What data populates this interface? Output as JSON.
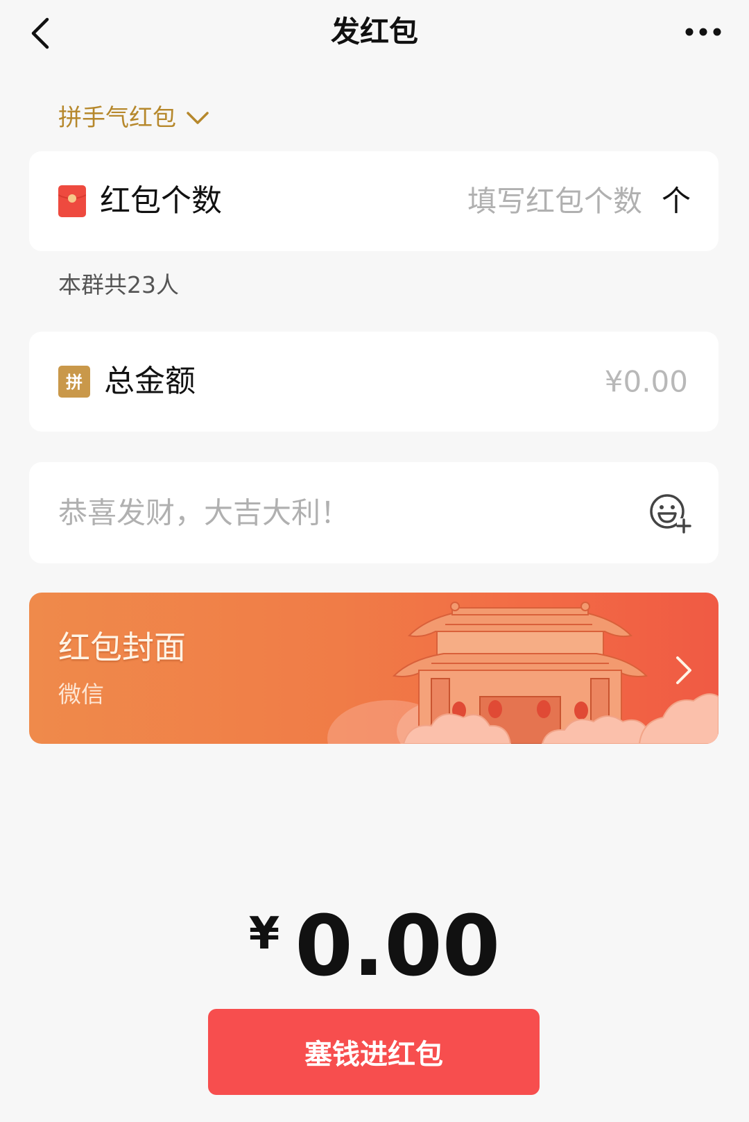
{
  "nav": {
    "title": "发红包",
    "back_icon": "chevron-left-icon",
    "more_icon": "more-horizontal-icon"
  },
  "packet_type": {
    "label": "拼手气红包",
    "icon": "chevron-down-icon"
  },
  "count_field": {
    "icon": "red-packet-icon",
    "label": "红包个数",
    "placeholder": "填写红包个数",
    "value": "",
    "unit": "个"
  },
  "group_note": "本群共23人",
  "amount_field": {
    "icon": "pin-badge-icon",
    "badge_text": "拼",
    "label": "总金额",
    "placeholder": "¥0.00",
    "value": ""
  },
  "greeting_field": {
    "placeholder": "恭喜发财，大吉大利！",
    "value": "",
    "emoji_icon": "emoji-add-icon"
  },
  "cover": {
    "title": "红包封面",
    "subtitle": "微信",
    "chevron_icon": "chevron-right-icon"
  },
  "total": {
    "currency": "¥",
    "value": "0.00"
  },
  "submit_button": {
    "label": "塞钱进红包"
  },
  "colors": {
    "accent_gold": "#b6882c",
    "button_red": "#f74e4e",
    "cover_orange": "#f07c47",
    "page_background": "#f7f7f7"
  }
}
